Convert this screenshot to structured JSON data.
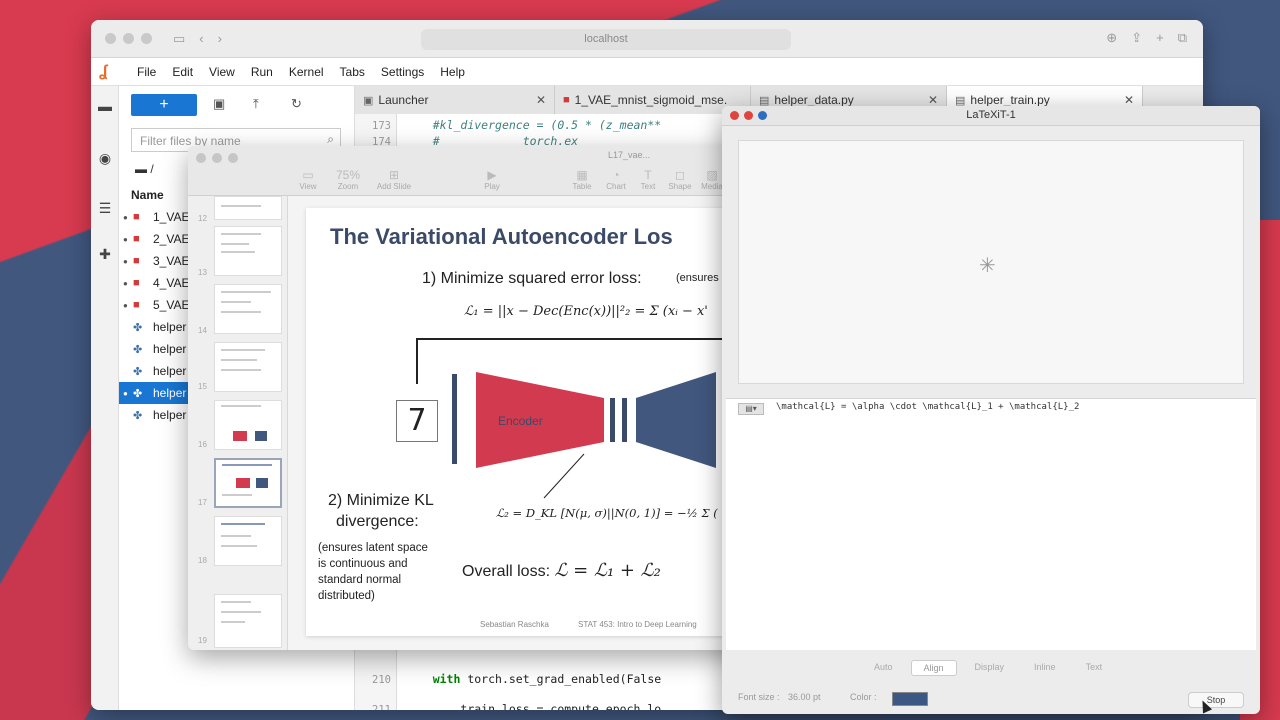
{
  "browser": {
    "url": "localhost"
  },
  "menubar": {
    "items": [
      "File",
      "Edit",
      "View",
      "Run",
      "Kernel",
      "Tabs",
      "Settings",
      "Help"
    ]
  },
  "filebrowser": {
    "new_label": "+",
    "filter_placeholder": "Filter files by name",
    "path": "/",
    "header": "Name",
    "files": [
      "1_VAE",
      "2_VAE",
      "3_VAE",
      "4_VAE",
      "5_VAE",
      "helper",
      "helper",
      "helper",
      "helper",
      "helper"
    ],
    "selected_index": 8
  },
  "tabs": [
    {
      "label": "Launcher"
    },
    {
      "label": "1_VAE_mnist_sigmoid_mse."
    },
    {
      "label": "helper_data.py"
    },
    {
      "label": "helper_train.py"
    }
  ],
  "code_top": [
    {
      "n": "173",
      "text": "#kl_divergence = (0.5 * (z_mean**"
    },
    {
      "n": "174",
      "text": "#            torch.ex"
    }
  ],
  "code_bottom": [
    {
      "n": "210",
      "kw": "with",
      "text": " torch.set_grad_enabled(False"
    },
    {
      "n": "211",
      "text": "    train_loss = compute_epoch_lo"
    }
  ],
  "keynote": {
    "title": "L17_vae...",
    "zoom": "75%",
    "tools": [
      "View",
      "Zoom",
      "Add Slide",
      "Play",
      "Table",
      "Chart",
      "Text",
      "Shape",
      "Media"
    ],
    "slide_numbers": [
      "12",
      "13",
      "14",
      "15",
      "16",
      "17",
      "18",
      "19"
    ]
  },
  "slide": {
    "title": "The Variational Autoencoder Los",
    "step1": "1) Minimize squared error loss:",
    "ensures1": "(ensures",
    "eq1": "ℒ₁ = ||x − Dec(Enc(x))||²₂ = Σ (xᵢ − x'",
    "digit": "7",
    "encoder_label": "Encoder",
    "step2_line1": "2) Minimize KL",
    "step2_line2": "divergence:",
    "ensures2_lines": [
      "(ensures latent space",
      "is continuous and",
      "standard normal",
      "distributed)"
    ],
    "eq2": "ℒ₂ = D_KL [N(μ, σ)||N(0, 1)] = −½ Σ (",
    "overall_label": "Overall loss:",
    "overall_eq": "ℒ = ℒ₁ + ℒ₂",
    "footer_author": "Sebastian Raschka",
    "footer_course": "STAT 453: Intro to Deep Learning"
  },
  "latexit": {
    "title": "LaTeXiT-1",
    "source": "\\mathcal{L} = \\alpha \\cdot \\mathcal{L}_1 + \\mathcal{L}_2",
    "modes": [
      "Auto",
      "Align",
      "Display",
      "Inline",
      "Text"
    ],
    "active_mode": "Align",
    "font_size_label": "Font size :",
    "font_size_value": "36.00 pt",
    "color_label": "Color :",
    "color_value": "#3b5784",
    "stop_label": "Stop"
  },
  "colors": {
    "accent_red": "#d23a4f",
    "accent_navy": "#41577e",
    "jupyter_blue": "#1976d2"
  }
}
